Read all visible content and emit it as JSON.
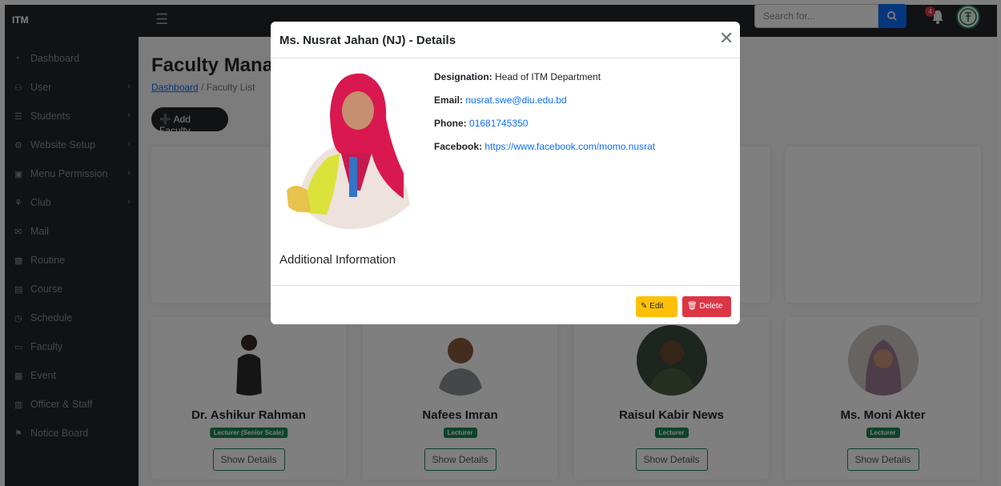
{
  "brand": "ITM",
  "search": {
    "placeholder": "Search for..."
  },
  "notifications": {
    "count": "4"
  },
  "sidebar": {
    "items": [
      {
        "label": "Dashboard",
        "icon": "dashboard-icon",
        "has_children": false
      },
      {
        "label": "User",
        "icon": "users-icon",
        "has_children": true
      },
      {
        "label": "Students",
        "icon": "students-icon",
        "has_children": true
      },
      {
        "label": "Website Setup",
        "icon": "gears-icon",
        "has_children": true
      },
      {
        "label": "Menu Permission",
        "icon": "lock-icon",
        "has_children": true
      },
      {
        "label": "Club",
        "icon": "club-icon",
        "has_children": true
      },
      {
        "label": "Mail",
        "icon": "mail-icon",
        "has_children": false
      },
      {
        "label": "Routine",
        "icon": "calendar-icon",
        "has_children": false
      },
      {
        "label": "Course",
        "icon": "book-icon",
        "has_children": false
      },
      {
        "label": "Schedule",
        "icon": "clock-icon",
        "has_children": false
      },
      {
        "label": "Faculty",
        "icon": "faculty-icon",
        "has_children": false
      },
      {
        "label": "Event",
        "icon": "event-icon",
        "has_children": false
      },
      {
        "label": "Officer & Staff",
        "icon": "staff-icon",
        "has_children": false
      },
      {
        "label": "Notice Board",
        "icon": "pin-icon",
        "has_children": false
      }
    ]
  },
  "page": {
    "title": "Faculty Management",
    "breadcrumb": {
      "home": "Dashboard",
      "separator": "/",
      "current": "Faculty List"
    },
    "add_button": "Add Faculty"
  },
  "faculty_cards": [
    {
      "name": "Dr. Ashikur Rahman",
      "designation": "Lecturer (Senior Scale)",
      "button": "Show Details"
    },
    {
      "name": "Nafees Imran",
      "designation": "Lecturer",
      "button": "Show Details"
    },
    {
      "name": "Raisul Kabir News",
      "designation": "Lecturer",
      "button": "Show Details"
    },
    {
      "name": "Ms. Moni Akter",
      "designation": "Lecturer",
      "button": "Show Details"
    }
  ],
  "modal": {
    "title": "Ms. Nusrat Jahan (NJ) - Details",
    "designation_label": "Designation:",
    "designation": "Head of ITM Department",
    "email_label": "Email:",
    "email": "nusrat.swe@diu.edu.bd",
    "phone_label": "Phone:",
    "phone": "01681745350",
    "facebook_label": "Facebook:",
    "facebook": "https://www.facebook.com/momo.nusrat",
    "additional_heading": "Additional Information",
    "edit_label": "Edit",
    "delete_label": "Delete"
  },
  "colors": {
    "dark": "#212529",
    "primary": "#0d6efd",
    "success": "#198754",
    "warning": "#ffc107",
    "danger": "#dc3545"
  }
}
